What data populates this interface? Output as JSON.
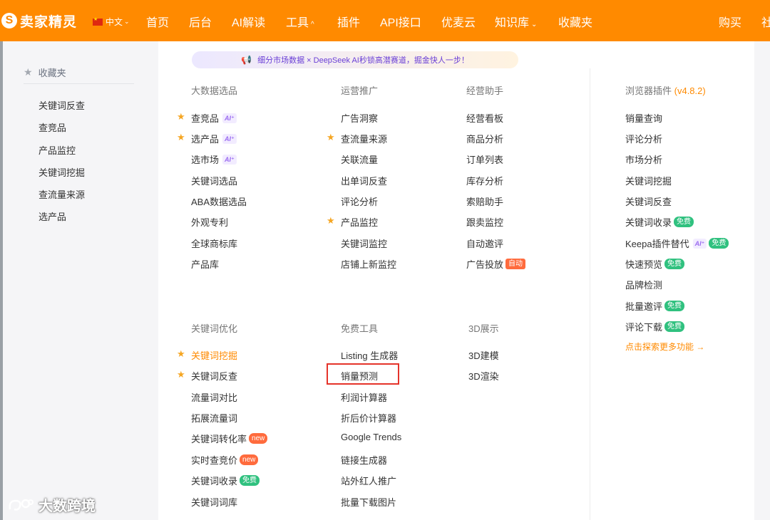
{
  "header": {
    "logo_text": "卖家精灵",
    "logo_mark": "S",
    "language": "中文",
    "nav": [
      {
        "label": "首页",
        "dropdown": false
      },
      {
        "label": "后台",
        "dropdown": false
      },
      {
        "label": "AI解读",
        "dropdown": false
      },
      {
        "label": "工具",
        "dropdown": true,
        "chevron": "^"
      },
      {
        "label": "插件",
        "dropdown": false
      },
      {
        "label": "API接口",
        "dropdown": false
      },
      {
        "label": "优麦云",
        "dropdown": false
      },
      {
        "label": "知识库",
        "dropdown": true,
        "chevron": "⌄"
      },
      {
        "label": "收藏夹",
        "dropdown": false
      },
      {
        "label": "购买",
        "dropdown": false
      },
      {
        "label": "社",
        "dropdown": false
      }
    ]
  },
  "sidebar": {
    "title": "收藏夹",
    "items": [
      "关键词反查",
      "查竞品",
      "产品监控",
      "关键词挖掘",
      "查流量来源",
      "选产品"
    ]
  },
  "banner": {
    "text": "细分市场数据 × DeepSeek AI秒锁高潜赛道，掘金快人一步！"
  },
  "columns": {
    "big_data": {
      "title": "大数据选品",
      "items": [
        {
          "label": "查竞品",
          "star": true,
          "ai": "AI"
        },
        {
          "label": "选产品",
          "star": true,
          "ai": "AI"
        },
        {
          "label": "选市场",
          "star": false,
          "ai": "AI"
        },
        {
          "label": "关键词选品"
        },
        {
          "label": "ABA数据选品"
        },
        {
          "label": "外观专利"
        },
        {
          "label": "全球商标库"
        },
        {
          "label": "产品库"
        }
      ]
    },
    "ops": {
      "title": "运营推广",
      "items": [
        {
          "label": "广告洞察"
        },
        {
          "label": "查流量来源",
          "star": true
        },
        {
          "label": "关联流量"
        },
        {
          "label": "出单词反查"
        },
        {
          "label": "评论分析"
        },
        {
          "label": "产品监控",
          "star": true
        },
        {
          "label": "关键词监控"
        },
        {
          "label": "店铺上新监控"
        }
      ]
    },
    "manage": {
      "title": "经营助手",
      "items": [
        {
          "label": "经营看板"
        },
        {
          "label": "商品分析"
        },
        {
          "label": "订单列表"
        },
        {
          "label": "库存分析"
        },
        {
          "label": "索赔助手"
        },
        {
          "label": "跟卖监控"
        },
        {
          "label": "自动邀评"
        },
        {
          "label": "广告投放",
          "badge": "自动"
        }
      ]
    },
    "plugin": {
      "title": "浏览器插件",
      "version": "(v4.8.2)",
      "items": [
        {
          "label": "销量查询"
        },
        {
          "label": "评论分析"
        },
        {
          "label": "市场分析"
        },
        {
          "label": "关键词挖掘"
        },
        {
          "label": "关键词反查"
        },
        {
          "label": "关键词收录",
          "badge": "免费"
        },
        {
          "label": "Keepa插件替代",
          "ai": "AI",
          "badge": "免费"
        },
        {
          "label": "快速预览",
          "badge": "免费"
        },
        {
          "label": "品牌检测"
        },
        {
          "label": "批量邀评",
          "badge": "免费"
        },
        {
          "label": "评论下载",
          "badge": "免费"
        }
      ],
      "more_link": "点击探索更多功能 →"
    },
    "keyword": {
      "title": "关键词优化",
      "items": [
        {
          "label": "关键词挖掘",
          "star": true,
          "active": true
        },
        {
          "label": "关键词反查",
          "star": true
        },
        {
          "label": "流量词对比"
        },
        {
          "label": "拓展流量词"
        },
        {
          "label": "关键词转化率",
          "badge": "new"
        },
        {
          "label": "实时查竞价",
          "badge": "new"
        },
        {
          "label": "关键词收录",
          "badge": "免费"
        },
        {
          "label": "关键词词库"
        }
      ]
    },
    "free": {
      "title": "免费工具",
      "items": [
        {
          "label": "Listing 生成器"
        },
        {
          "label": "销量预测",
          "highlighted": true
        },
        {
          "label": "利润计算器"
        },
        {
          "label": "折后价计算器"
        },
        {
          "label": "Google Trends"
        },
        {
          "label": "链接生成器"
        },
        {
          "label": "站外红人推广"
        },
        {
          "label": "批量下载图片"
        }
      ]
    },
    "three_d": {
      "title": "3D展示",
      "items": [
        {
          "label": "3D建模"
        },
        {
          "label": "3D渲染"
        }
      ]
    }
  },
  "watermark": {
    "text": "大数跨境"
  },
  "colors": {
    "brand": "#ff8a00",
    "star": "#f5a623",
    "free_badge": "#30c17f",
    "new_badge": "#ff6b3d",
    "highlight_border": "#e5332a"
  }
}
